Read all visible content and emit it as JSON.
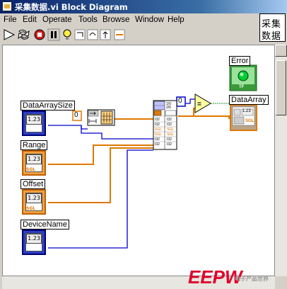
{
  "window": {
    "title": "采集数据.vi Block Diagram"
  },
  "menu": [
    "File",
    "Edit",
    "Operate",
    "Tools",
    "Browse",
    "Window",
    "Help"
  ],
  "toolbar": {
    "font": "13pt Application Font"
  },
  "vi_icon": [
    "采集",
    "数据"
  ],
  "controls": [
    {
      "label": "DataArraySize",
      "value": "1.23",
      "type": ""
    },
    {
      "label": "Range",
      "value": "1.23",
      "type": "SGL"
    },
    {
      "label": "Offset",
      "value": "1.23",
      "type": "SGL"
    },
    {
      "label": "DeviceName",
      "value": "1.23",
      "type": ""
    }
  ],
  "constants": {
    "zero_left": "0",
    "zero_right": "0"
  },
  "indicators": {
    "error": {
      "label": "Error",
      "type": "TF"
    },
    "dataarray": {
      "label": "DataArray",
      "value": "1.23",
      "type": "SGL"
    }
  },
  "watermark": {
    "text": "EEPW",
    "sub": "电子产品世界"
  },
  "colors": {
    "blue_wire": "#0000cc",
    "orange_wire": "#e07800",
    "green_led": "#00cc33"
  }
}
